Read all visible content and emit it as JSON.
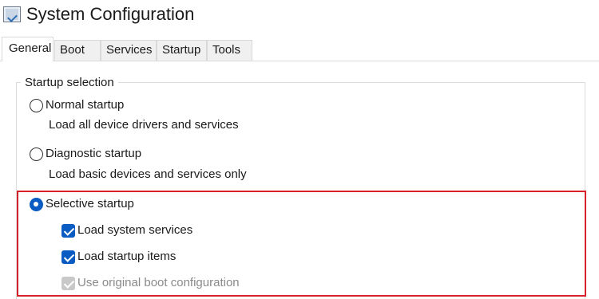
{
  "window": {
    "title": "System Configuration",
    "icon": "msconfig-icon"
  },
  "tabs": [
    {
      "label": "General",
      "active": true
    },
    {
      "label": "Boot",
      "active": false
    },
    {
      "label": "Services",
      "active": false
    },
    {
      "label": "Startup",
      "active": false
    },
    {
      "label": "Tools",
      "active": false
    }
  ],
  "startup_selection": {
    "group_label": "Startup selection",
    "normal": {
      "label": "Normal startup",
      "description": "Load all device drivers and services",
      "selected": false
    },
    "diagnostic": {
      "label": "Diagnostic startup",
      "description": "Load basic devices and services only",
      "selected": false
    },
    "selective": {
      "label": "Selective startup",
      "selected": true,
      "options": {
        "load_system_services": {
          "label": "Load system services",
          "checked": true,
          "enabled": true
        },
        "load_startup_items": {
          "label": "Load startup items",
          "checked": true,
          "enabled": true
        },
        "use_original_boot": {
          "label": "Use original boot configuration",
          "checked": true,
          "enabled": false
        }
      }
    }
  },
  "annotation": {
    "highlight_color": "#d6202a"
  },
  "colors": {
    "accent": "#0a5cc2",
    "disabled": "#c8c8c8"
  }
}
